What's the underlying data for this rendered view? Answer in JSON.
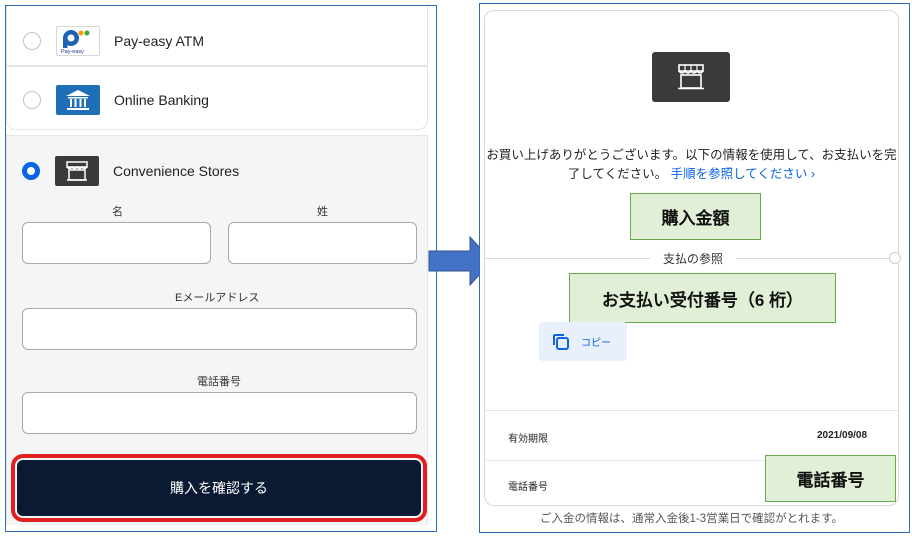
{
  "left": {
    "options": [
      {
        "id": "payeasy",
        "label": "Pay-easy ATM",
        "selected": false,
        "logo_text": "Pay-easy"
      },
      {
        "id": "banking",
        "label": "Online Banking",
        "selected": false
      },
      {
        "id": "convenience",
        "label": "Convenience Stores",
        "selected": true
      }
    ],
    "form": {
      "first_name_label": "名",
      "last_name_label": "姓",
      "email_label": "Eメールアドレス",
      "phone_label": "電話番号",
      "first_name_value": "",
      "last_name_value": "",
      "email_value": "",
      "phone_value": ""
    },
    "confirm_button": "購入を確認する",
    "colors": {
      "accent": "#0b64e6",
      "button_bg": "#0b1a33",
      "highlight": "#e02020"
    }
  },
  "right": {
    "thanks_text": "お買い上げありがとうございます。以下の情報を使用して、お支払いを完了してください。",
    "instructions_link": "手順を参照してください ›",
    "amount_note": "購入金額",
    "reference_label": "支払の参照",
    "reference_note": "お支払い受付番号（6 桁）",
    "copy_button": "コピー",
    "expiry_label": "有効期限",
    "expiry_value": "2021/09/08",
    "phone_label": "電話番号",
    "phone_note": "電話番号",
    "footnote": "ご入金の情報は、通常入金後1-3営業日で確認がとれます。",
    "colors": {
      "note_bg": "#e1efd6",
      "note_border": "#6aa84f",
      "link": "#0b64e6"
    }
  }
}
